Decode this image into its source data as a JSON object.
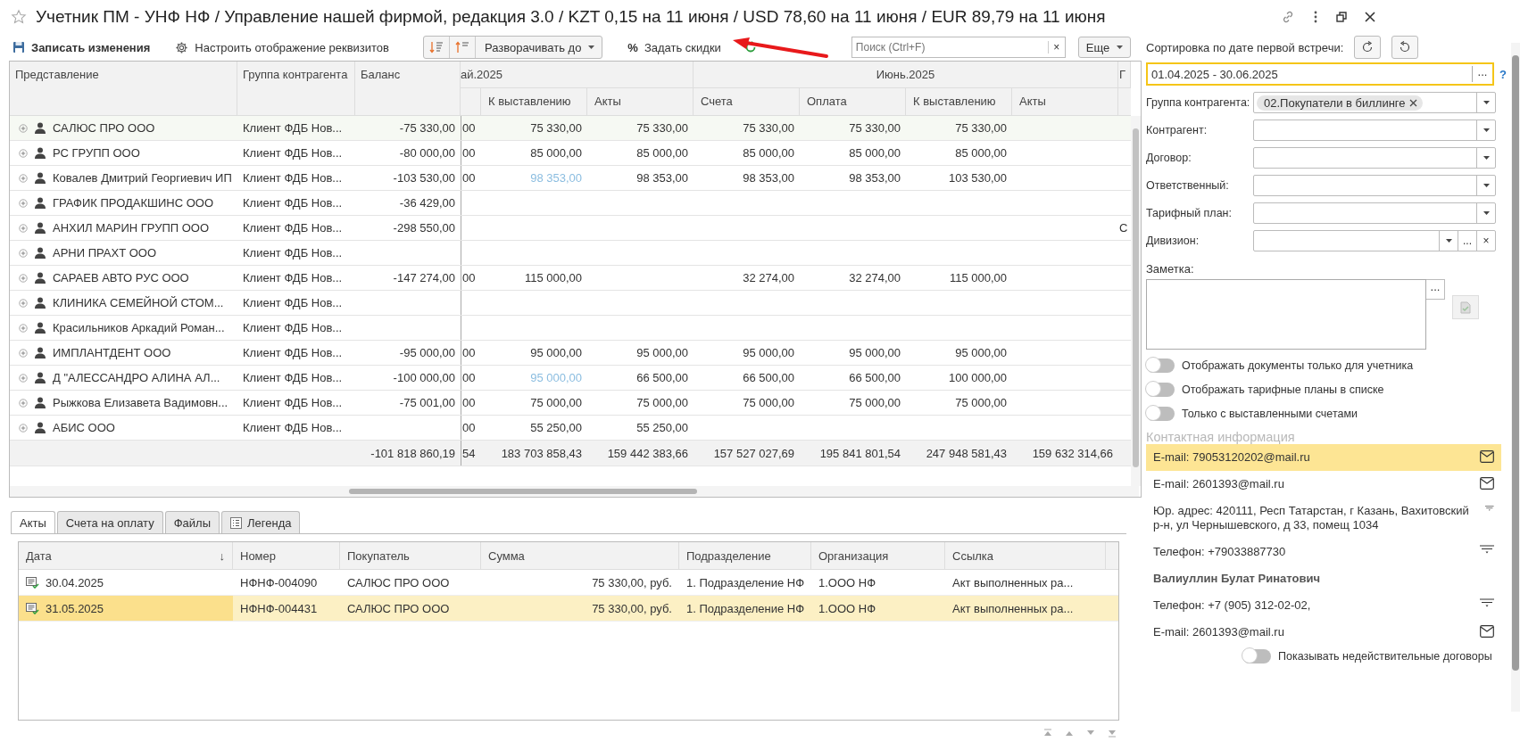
{
  "window": {
    "title": "Учетник ПМ - УНФ НФ / Управление нашей фирмой, редакция 3.0 / KZT 0,15 на 11 июня / USD 78,60 на 11 июня / EUR 89,79 на 11 июня",
    "favorite": false
  },
  "toolbar": {
    "save": "Записать изменения",
    "settings": "Настроить отображение реквизитов",
    "expand": "Разворачивать до",
    "discount_symbol": "%",
    "discounts": "Задать скидки",
    "search": {
      "placeholder": "Поиск (Ctrl+F)",
      "clear": "×"
    },
    "more": "Еще"
  },
  "report": {
    "columns": [
      "Представление",
      "Группа контрагента",
      "Баланс"
    ],
    "periods": [
      {
        "label": "ай.2025",
        "columns": [
          {
            "kind": "cut_left"
          },
          {
            "kind": "full",
            "label": "К выставлению"
          },
          {
            "kind": "full",
            "label": "Акты"
          }
        ]
      },
      {
        "label": "Июнь.2025",
        "columns": [
          {
            "kind": "full",
            "label": "Счета"
          },
          {
            "kind": "full",
            "label": "Оплата"
          },
          {
            "kind": "full",
            "label": "К выставлению"
          },
          {
            "kind": "full",
            "label": "Акты"
          }
        ]
      },
      {
        "label": "Г",
        "columns": [
          {
            "kind": "cut_right"
          }
        ]
      }
    ],
    "rows": [
      {
        "name": "САЛЮС ПРО ООО",
        "group": "Клиент ФДБ Нов...",
        "balance": "-75 330,00",
        "values": {
          "column_4": "00",
          "may_billing": "75 330,00",
          "may_acts": "75 330,00",
          "jun_invoices": "75 330,00",
          "jun_payment": "75 330,00",
          "jun_billing": "75 330,00"
        },
        "selected": true
      },
      {
        "name": "РС ГРУПП ООО",
        "group": "Клиент ФДБ Нов...",
        "balance": "-80 000,00",
        "values": {
          "column_4": "00",
          "may_billing": "85 000,00",
          "may_acts": "85 000,00",
          "jun_invoices": "85 000,00",
          "jun_payment": "85 000,00",
          "jun_billing": "85 000,00"
        },
        "selected": false
      },
      {
        "name": "Ковалев Дмитрий Георгиевич ИП",
        "group": "Клиент ФДБ Нов...",
        "balance": "-103 530,00",
        "values": {
          "column_4": "00",
          "may_billing": {
            "text": "98 353,00",
            "linked": true
          },
          "may_acts": "98 353,00",
          "jun_invoices": "98 353,00",
          "jun_payment": "98 353,00",
          "jun_billing": "103 530,00"
        },
        "selected": false
      },
      {
        "name": "ГРАФИК ПРОДАКШИНС ООО",
        "group": "Клиент ФДБ Нов...",
        "balance": "-36 429,00",
        "selected": false
      },
      {
        "name": "АНХИЛ МАРИН ГРУПП ООО",
        "group": "Клиент ФДБ Нов...",
        "balance": "-298 550,00",
        "values": {
          "column_11": "С"
        },
        "selected": false
      },
      {
        "name": "АРНИ ПРАХТ ООО",
        "group": "Клиент ФДБ Нов...",
        "selected": false
      },
      {
        "name": "САРАЕВ АВТО РУС ООО",
        "group": "Клиент ФДБ Нов...",
        "balance": "-147 274,00",
        "values": {
          "column_4": "00",
          "may_billing": "115 000,00",
          "jun_invoices": "32 274,00",
          "jun_payment": "32 274,00",
          "jun_billing": "115 000,00"
        },
        "selected": false
      },
      {
        "name": "КЛИНИКА СЕМЕЙНОЙ СТОМ...",
        "group": "Клиент ФДБ Нов...",
        "selected": false
      },
      {
        "name": "Красильников Аркадий Роман...",
        "group": "Клиент ФДБ Нов...",
        "selected": false
      },
      {
        "name": "ИМПЛАНТДЕНТ ООО",
        "group": "Клиент ФДБ Нов...",
        "balance": "-95 000,00",
        "values": {
          "column_4": "00",
          "may_billing": "95 000,00",
          "may_acts": "95 000,00",
          "jun_invoices": "95 000,00",
          "jun_payment": "95 000,00",
          "jun_billing": "95 000,00"
        },
        "selected": false
      },
      {
        "name": "Д \"АЛЕССАНДРО АЛИНА АЛ...",
        "group": "Клиент ФДБ Нов...",
        "balance": "-100 000,00",
        "values": {
          "column_4": "00",
          "may_billing": {
            "text": "95 000,00",
            "linked": true
          },
          "may_acts": "66 500,00",
          "jun_invoices": "66 500,00",
          "jun_payment": "66 500,00",
          "jun_billing": "100 000,00"
        },
        "selected": false
      },
      {
        "name": "Рыжкова Елизавета Вадимовн...",
        "group": "Клиент ФДБ Нов...",
        "balance": "-75 001,00",
        "values": {
          "column_4": "00",
          "may_billing": "75 000,00",
          "may_acts": "75 000,00",
          "jun_invoices": "75 000,00",
          "jun_payment": "75 000,00",
          "jun_billing": "75 000,00"
        },
        "selected": false
      },
      {
        "name": "АБИС ООО",
        "group": "Клиент ФДБ Нов...",
        "values": {
          "column_4": "00",
          "may_billing": "55 250,00",
          "may_acts": "55 250,00"
        },
        "selected": false
      }
    ],
    "totals": {
      "balance": "-101 818 860,19",
      "values": {
        "column_4": "54",
        "may_billing": "183 703 858,43",
        "may_acts": "159 442 383,66",
        "jun_invoices": "157 527 027,69",
        "jun_payment": "195 841 801,54",
        "jun_billing": "247 948 581,43",
        "jun_acts": "159 632 314,66"
      }
    }
  },
  "tabs": [
    {
      "label": "Акты",
      "selected": true,
      "kind": "plain"
    },
    {
      "label": "Счета на оплату",
      "selected": false,
      "kind": "plain"
    },
    {
      "label": "Файлы",
      "selected": false,
      "kind": "plain"
    },
    {
      "label": "Легенда",
      "selected": false,
      "kind": "legend"
    }
  ],
  "documents": {
    "columns": [
      "Дата",
      "Номер",
      "Покупатель",
      "Сумма",
      "Подразделение",
      "Организация",
      "Ссылка"
    ],
    "sort_mark": "↓",
    "rows": [
      {
        "date": "30.04.2025",
        "number": "НФНФ-004090",
        "buyer": "САЛЮС ПРО ООО",
        "sum": "75 330,00, руб.",
        "department": "1. Подразделение НФ",
        "organization": "1.ООО НФ",
        "link": "Акт выполненных ра...",
        "selected": false
      },
      {
        "date": "31.05.2025",
        "number": "НФНФ-004431",
        "buyer": "САЛЮС ПРО ООО",
        "sum": "75 330,00, руб.",
        "department": "1. Подразделение НФ",
        "organization": "1.ООО НФ",
        "link": "Акт выполненных ра...",
        "selected": true
      }
    ]
  },
  "filters": {
    "sort_label": "Сортировка по дате первой встречи:",
    "period": {
      "value": "01.04.2025 - 30.06.2025",
      "more": "...",
      "help": "?"
    },
    "fields": [
      {
        "label": "Группа контрагента:",
        "tag": "02.Покупатели в биллинге",
        "kind": "select"
      },
      {
        "label": "Контрагент:",
        "kind": "select"
      },
      {
        "label": "Договор:",
        "kind": "select"
      },
      {
        "label": "Ответственный:",
        "kind": "select"
      },
      {
        "label": "Тарифный план:",
        "kind": "select"
      },
      {
        "label": "Дивизион:",
        "kind": "choice",
        "more": "...",
        "clear": "×"
      }
    ],
    "note": {
      "label": "Заметка:",
      "more": "..."
    },
    "toggles": [
      {
        "label": "Отображать документы только для учетника",
        "on": false
      },
      {
        "label": "Отображать тарифные планы в списке",
        "on": false
      },
      {
        "label": "Только с выставленными счетами",
        "on": false
      }
    ]
  },
  "contacts": {
    "title": "Контактная информация",
    "items": [
      {
        "text": "E-mail: 79053120202@mail.ru",
        "kind": "email",
        "selected": true
      },
      {
        "text": "E-mail: 2601393@mail.ru",
        "kind": "email",
        "selected": false
      },
      {
        "text": "Юр. адрес: 420111, Респ Татарстан, г Казань, Вахитовский р-н, ул Чернышевского, д 33, помещ 1034",
        "kind": "address",
        "selected": false
      },
      {
        "text": "Телефон: +79033887730",
        "kind": "phone",
        "selected": false
      },
      {
        "text": "Валиуллин Булат Ринатович",
        "kind": "person",
        "selected": false
      },
      {
        "text": "Телефон: +7 (905) 312-02-02,",
        "kind": "phone",
        "selected": false
      },
      {
        "text": "E-mail: 2601393@mail.ru",
        "kind": "email",
        "selected": false
      }
    ]
  },
  "bottom_toggle": {
    "label": "Показывать недействительные договоры",
    "on": false
  }
}
